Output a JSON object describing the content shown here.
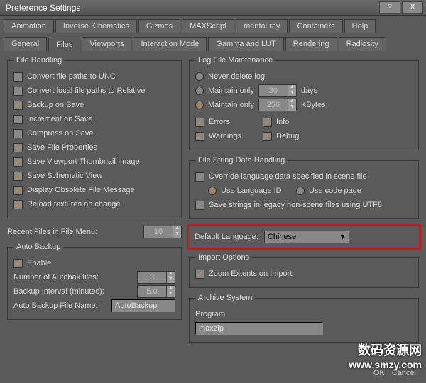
{
  "window": {
    "title": "Preference Settings",
    "help": "?",
    "close": "X"
  },
  "tabs_row1": [
    "Animation",
    "Inverse Kinematics",
    "Gizmos",
    "MAXScript",
    "mental ray",
    "Containers",
    "Help"
  ],
  "tabs_row2": [
    "General",
    "Files",
    "Viewports",
    "Interaction Mode",
    "Gamma and LUT",
    "Rendering",
    "Radiosity"
  ],
  "active_tab": "Files",
  "fileHandling": {
    "legend": "File Handling",
    "convertUNC": "Convert file paths to UNC",
    "convertRel": "Convert local file paths to Relative",
    "backup": "Backup on Save",
    "incr": "Increment on Save",
    "compress": "Compress on Save",
    "saveProps": "Save File Properties",
    "saveThumb": "Save Viewport Thumbnail Image",
    "saveSchem": "Save Schematic View",
    "dispObs": "Display Obsolete File Message",
    "reloadTex": "Reload textures on change",
    "recentLbl": "Recent Files in File Menu:",
    "recentVal": "10"
  },
  "autoBackup": {
    "legend": "Auto Backup",
    "enable": "Enable",
    "numLbl": "Number of Autobak files:",
    "numVal": "3",
    "intLbl": "Backup Interval (minutes):",
    "intVal": "5.0",
    "nameLbl": "Auto Backup File Name:",
    "nameVal": "AutoBackup"
  },
  "logFile": {
    "legend": "Log File Maintenance",
    "never": "Never delete log",
    "maintainDays": "Maintain only",
    "daysVal": "30",
    "daysUnit": "days",
    "maintainKB": "Maintain only",
    "kbVal": "256",
    "kbUnit": "KBytes",
    "errors": "Errors",
    "info": "Info",
    "warnings": "Warnings",
    "debug": "Debug"
  },
  "fileString": {
    "legend": "File String Data Handling",
    "override": "Override language data specified in scene file",
    "useLang": "Use Language ID",
    "useCP": "Use code page",
    "utf8": "Save strings in legacy non-scene files using UTF8"
  },
  "defaultLang": {
    "label": "Default Language:",
    "value": "Chinese"
  },
  "importOpt": {
    "legend": "Import Options",
    "zoom": "Zoom Extents on Import"
  },
  "archive": {
    "legend": "Archive System",
    "progLbl": "Program:",
    "progVal": "maxzip"
  },
  "buttons": {
    "ok": "OK",
    "cancel": "Cancel"
  },
  "watermark": {
    "line1": "数码资源网",
    "line2": "www.smzy.com"
  }
}
